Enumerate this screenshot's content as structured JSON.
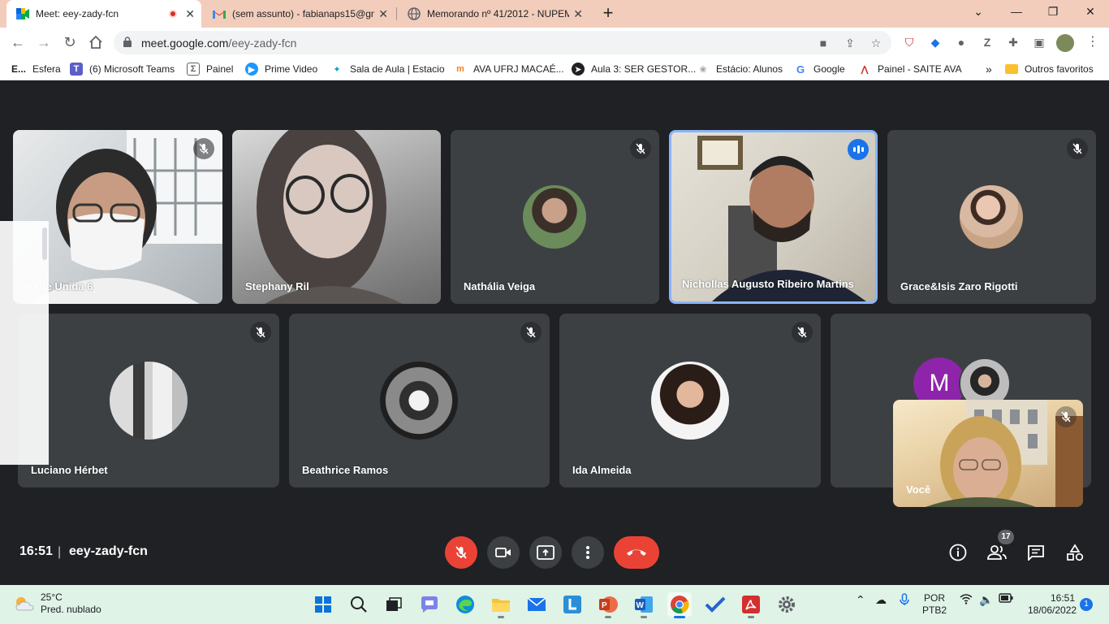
{
  "tabs": [
    {
      "title": "Meet: eey-zady-fcn",
      "active": true
    },
    {
      "title": "(sem assunto) - fabianaps15@gm",
      "active": false
    },
    {
      "title": "Memorando nº 41/2012 - NUPEM",
      "active": false
    }
  ],
  "omnibox": {
    "domain": "meet.google.com",
    "path": "/eey-zady-fcn"
  },
  "bookmarks": [
    {
      "label": "Esfera",
      "icon": "E..."
    },
    {
      "label": "(6) Microsoft Teams"
    },
    {
      "label": "Painel"
    },
    {
      "label": "Prime Video"
    },
    {
      "label": "Sala de Aula | Estacio"
    },
    {
      "label": "AVA UFRJ MACAÉ..."
    },
    {
      "label": "Aula 3: SER GESTOR..."
    },
    {
      "label": "Estácio: Alunos"
    },
    {
      "label": "Google"
    },
    {
      "label": "Painel - SAITE AVA"
    },
    {
      "label": "Outros favoritos"
    }
  ],
  "participants": [
    {
      "name": "Rede Unida 6"
    },
    {
      "name": "Stephany Ril"
    },
    {
      "name": "Nathália Veiga"
    },
    {
      "name": "Nichollas Augusto Ribeiro Martins"
    },
    {
      "name": "Grace&Isis Zaro Rigotti"
    },
    {
      "name": "Luciano Hérbet"
    },
    {
      "name": "Beathrice Ramos"
    },
    {
      "name": "Ida Almeida"
    },
    {
      "name": "",
      "initial": "M"
    }
  ],
  "self_view": {
    "label": "Você"
  },
  "meeting": {
    "time": "16:51",
    "code": "eey-zady-fcn",
    "participant_count": "17"
  },
  "taskbar": {
    "weather_temp": "25°C",
    "weather_cond": "Pred. nublado",
    "lang_top": "POR",
    "lang_bottom": "PTB2",
    "time": "16:51",
    "date": "18/06/2022",
    "notifications": "1"
  },
  "colors": {
    "meet_bg": "#202124",
    "tile_bg": "#3c4043",
    "hangup_red": "#ea4335",
    "speaking_blue": "#8ab4f8",
    "tabstrip": "#f2cdbb",
    "taskbar": "#dff3e7"
  }
}
